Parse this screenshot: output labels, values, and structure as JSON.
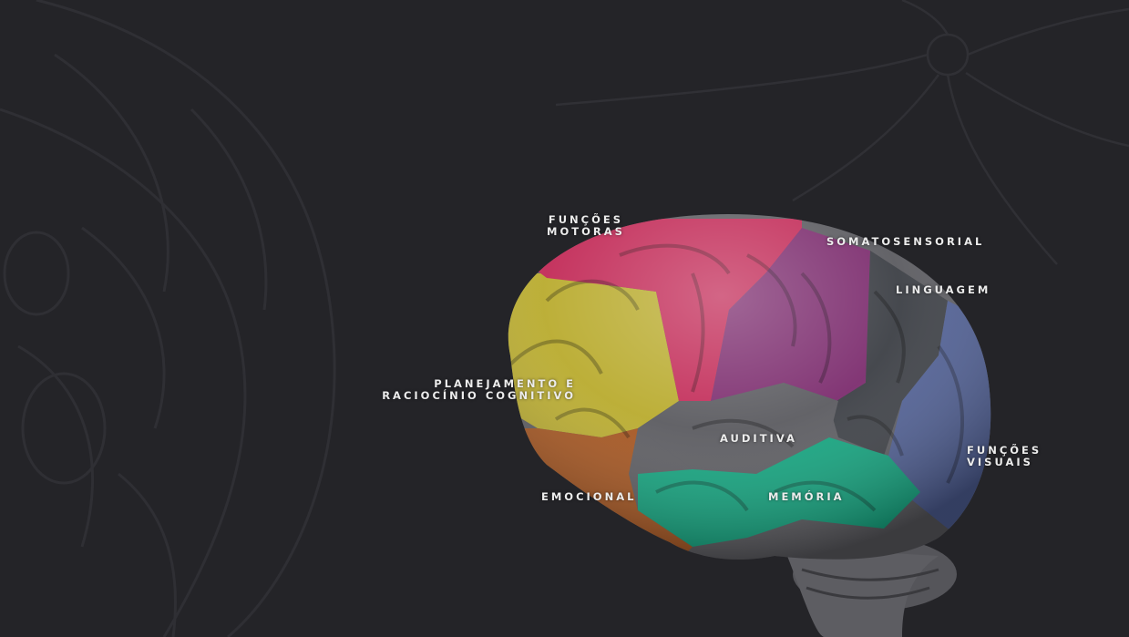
{
  "regions": [
    {
      "id": "motoras",
      "lines": [
        "FUNÇÕES",
        "MOTORAS"
      ],
      "color": "#c22a57"
    },
    {
      "id": "somatosensorial",
      "lines": [
        "SOMATOSENSORIAL"
      ],
      "color": "#7c2c6e"
    },
    {
      "id": "linguagem",
      "lines": [
        "LINGUAGEM"
      ],
      "color": "#3c3f45"
    },
    {
      "id": "planejamento",
      "lines": [
        "PLANEJAMENTO E",
        "RACIOCÍNIO COGNITIVO"
      ],
      "color": "#b9ab2e"
    },
    {
      "id": "auditiva",
      "lines": [
        "AUDITIVA"
      ],
      "color": "#5b5b60"
    },
    {
      "id": "visuais",
      "lines": [
        "FUNÇÕES",
        "VISUAIS"
      ],
      "color": "#4f5f95"
    },
    {
      "id": "emocional",
      "lines": [
        "EMOCIONAL"
      ],
      "color": "#a5541e"
    },
    {
      "id": "memoria",
      "lines": [
        "MEMÓRIA"
      ],
      "color": "#11a47e"
    }
  ],
  "background_color": "#242428"
}
